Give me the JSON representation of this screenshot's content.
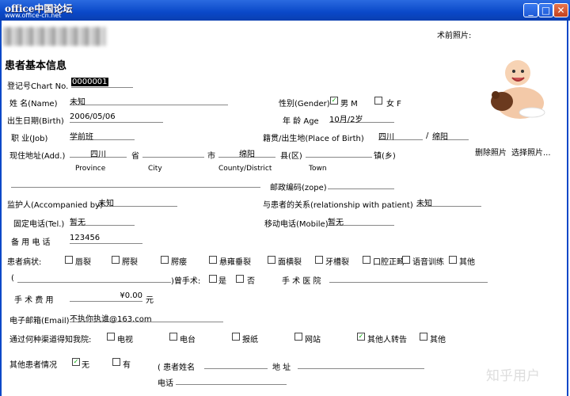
{
  "window": {
    "watermark": "office中国论坛",
    "watermark_url": "www.office-cn.net",
    "min": "_",
    "max": "□",
    "close": "✕"
  },
  "header": {
    "photo_label": "术前照片:",
    "section_title": "患者基本信息"
  },
  "labels": {
    "chart_no": "登记号Chart No.",
    "name": "姓    名(Name)",
    "gender": "性别(Gender)",
    "male": "男 M",
    "female": "女 F",
    "birth": "出生日期(Birth)",
    "age": "年  龄 Age",
    "job": "职    业(Job)",
    "native": "籍贯/出生地(Place of Birth)",
    "slash": "/",
    "delete_photo": "删除照片",
    "choose_photo": "选择照片...",
    "address": "现住地址(Add.)",
    "province_cn": "省",
    "city_cn": "市",
    "county_cn": "县(区)",
    "town_cn": "镇(乡)",
    "province_en": "Province",
    "city_en": "City",
    "county_en": "County/District",
    "town_en": "Town",
    "zip": "邮政编码(zope)",
    "guardian": "监护人(Accompanied by)",
    "relation": "与患者的关系(relationship with patient)",
    "tel": "固定电话(Tel.)",
    "mobile": "移动电话(Mobile)",
    "backup_tel": "备  用  电  话",
    "condition": "患者病状:",
    "surgery_before": ")曾手术:",
    "yes": "是",
    "no": "否",
    "hospital": "手 术 医 院",
    "fee": "手  术  费  用",
    "email": "电子邮箱(Email)",
    "channel": "通过何种渠道得知我院:",
    "others": "其他患者情况",
    "other_yes": "无",
    "other_no": "有",
    "patient_name": "( 患者姓名",
    "patient_addr": "地  址",
    "patient_tel": "电话",
    "open_paren": "("
  },
  "values": {
    "chart_no": "0000001",
    "name": "未知",
    "birth": "2006/05/06",
    "age": "10月/2岁",
    "job": "学前班",
    "native_province": "四川",
    "native_city": "绵阳",
    "addr_province": "四川",
    "addr_city": "绵阳",
    "guardian": "未知",
    "relation": "未知",
    "tel": "暂无",
    "mobile": "暂无",
    "backup_tel": "123456",
    "fee": "¥0.00",
    "fee_unit": "元",
    "email": "不执你执谁@163.com"
  },
  "conditions": [
    "唇裂",
    "腭裂",
    "腭瘘",
    "悬雍垂裂",
    "面横裂",
    "牙槽裂",
    "口腔正畸",
    "语音训练",
    "其他"
  ],
  "channels": [
    "电视",
    "电台",
    "报纸",
    "网站",
    "其他人转告",
    "其他"
  ],
  "checked": {
    "male": true,
    "female": false,
    "channel_others_ref": true,
    "other_yes": true
  },
  "footer_watermark": "知乎用户"
}
